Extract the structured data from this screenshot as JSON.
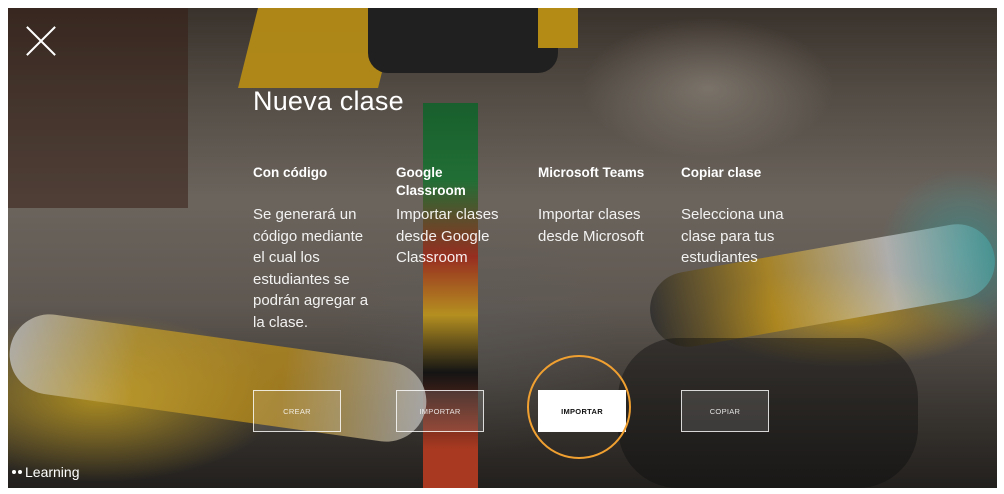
{
  "dialog": {
    "title": "Nueva clase",
    "options": [
      {
        "title": "Con código",
        "description": "Se generará un código mediante el cual los estudiantes se podrán agregar a la clase.",
        "button": "CREAR"
      },
      {
        "title": "Google Classroom",
        "description": "Importar clases desde Google Classroom",
        "button": "IMPORTAR"
      },
      {
        "title": "Microsoft Teams",
        "description": "Importar clases desde Microsoft",
        "button": "IMPORTAR"
      },
      {
        "title": "Copiar clase",
        "description": "Selecciona una clase para tus estudiantes",
        "button": "COPIAR"
      }
    ]
  },
  "brand": {
    "name": "Learning"
  },
  "icons": {
    "close": "close-icon",
    "brand": "dots-icon"
  },
  "colors": {
    "highlight_ring": "#f0a030",
    "text": "#ffffff",
    "active_button_bg": "#ffffff"
  }
}
